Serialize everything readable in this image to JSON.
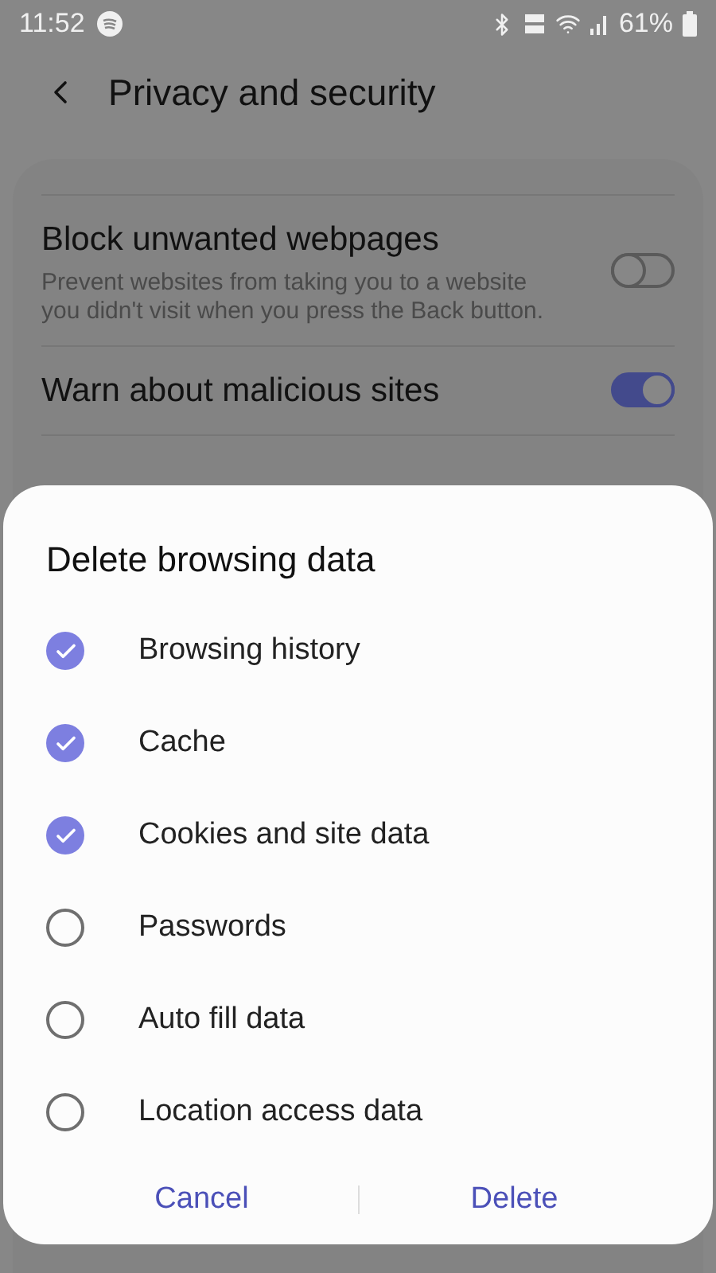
{
  "status_bar": {
    "time": "11:52",
    "battery": "61%"
  },
  "header": {
    "title": "Privacy and security"
  },
  "settings": [
    {
      "title": "Block unwanted webpages",
      "description": "Prevent websites from taking you to a website you didn't visit when you press the Back button.",
      "on": false
    },
    {
      "title": "Warn about malicious sites",
      "on": true
    }
  ],
  "dialog": {
    "title": "Delete browsing data",
    "options": [
      {
        "label": "Browsing history",
        "checked": true
      },
      {
        "label": "Cache",
        "checked": true
      },
      {
        "label": "Cookies and site data",
        "checked": true
      },
      {
        "label": "Passwords",
        "checked": false
      },
      {
        "label": "Auto fill data",
        "checked": false
      },
      {
        "label": "Location access data",
        "checked": false
      }
    ],
    "buttons": [
      "Cancel",
      "Delete"
    ]
  }
}
